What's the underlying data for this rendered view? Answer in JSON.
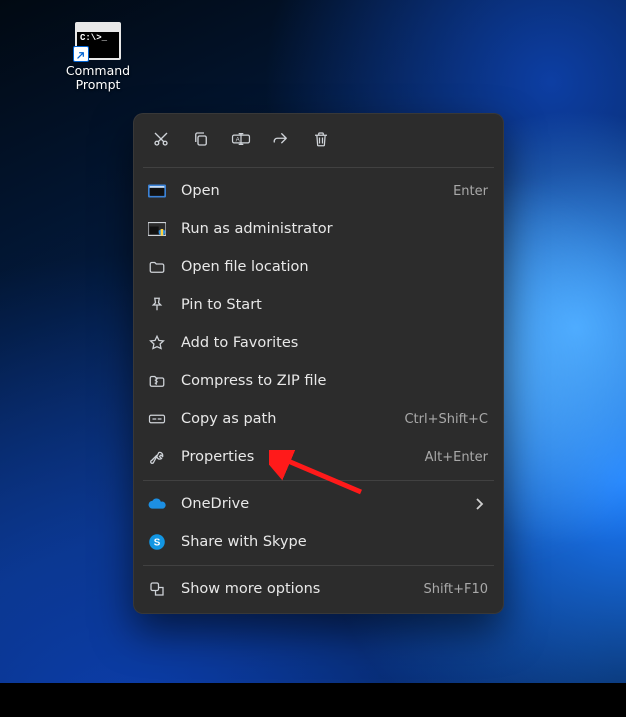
{
  "desktop_icon": {
    "name": "cmd-shortcut",
    "label": "Command\nPrompt",
    "prompt_glyph": "C:\\>_"
  },
  "quick_actions": [
    {
      "name": "cut-icon"
    },
    {
      "name": "copy-icon"
    },
    {
      "name": "rename-icon"
    },
    {
      "name": "share-icon"
    },
    {
      "name": "delete-icon"
    }
  ],
  "menu": {
    "group1": [
      {
        "icon": "app-icon",
        "label": "Open",
        "accel": "Enter"
      },
      {
        "icon": "shield-icon",
        "label": "Run as administrator",
        "accel": ""
      },
      {
        "icon": "folder-open-icon",
        "label": "Open file location",
        "accel": ""
      },
      {
        "icon": "pin-icon",
        "label": "Pin to Start",
        "accel": ""
      },
      {
        "icon": "star-icon",
        "label": "Add to Favorites",
        "accel": ""
      },
      {
        "icon": "zip-icon",
        "label": "Compress to ZIP file",
        "accel": ""
      },
      {
        "icon": "copy-path-icon",
        "label": "Copy as path",
        "accel": "Ctrl+Shift+C"
      },
      {
        "icon": "wrench-icon",
        "label": "Properties",
        "accel": "Alt+Enter"
      }
    ],
    "group2": [
      {
        "icon": "onedrive-icon",
        "label": "OneDrive",
        "submenu": true
      },
      {
        "icon": "skype-icon",
        "label": "Share with Skype",
        "accel": ""
      }
    ],
    "group3": [
      {
        "icon": "more-options-icon",
        "label": "Show more options",
        "accel": "Shift+F10"
      }
    ]
  },
  "annotation": {
    "color": "#ff1a1a"
  }
}
